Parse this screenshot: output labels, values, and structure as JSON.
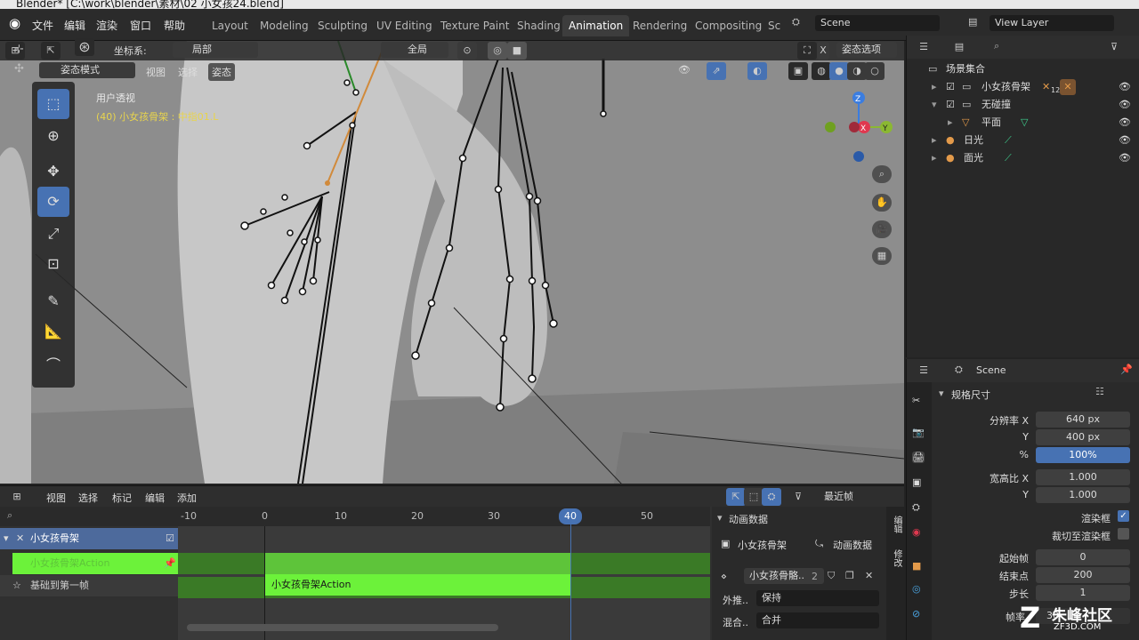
{
  "window": {
    "title": "Blender* [C:\\work\\blender\\素材\\02 小女孩24.blend]"
  },
  "top_menu": [
    "文件",
    "编辑",
    "渲染",
    "窗口",
    "帮助"
  ],
  "workspaces": [
    "Layout",
    "Modeling",
    "Sculpting",
    "UV Editing",
    "Texture Paint",
    "Shading",
    "Animation",
    "Rendering",
    "Compositing",
    "Sc"
  ],
  "active_workspace": "Animation",
  "scene_field": "Scene",
  "view_layer_field": "View Layer",
  "header": {
    "coord_label": "坐标系:",
    "coord_value": "局部",
    "pivot_value": "全局",
    "pose_options": "姿态选项"
  },
  "viewport": {
    "mode": "姿态模式",
    "menus": [
      "视图",
      "选择",
      "姿态"
    ],
    "view_name": "用户透视",
    "selected_info": "(40) 小女孩骨架 : 中指01.L",
    "gizmo": {
      "z": "Z",
      "x": "X",
      "y": "Y"
    }
  },
  "outliner": {
    "search_placeholder": "",
    "rows": [
      {
        "label": "场景集合"
      },
      {
        "label": "小女孩骨架",
        "badge": "12"
      },
      {
        "label": "无碰撞"
      },
      {
        "label": "平面"
      },
      {
        "label": "日光"
      },
      {
        "label": "面光"
      }
    ]
  },
  "properties": {
    "scene": "Scene",
    "section": "规格尺寸",
    "fields": [
      {
        "label": "分辨率 X",
        "value": "640 px"
      },
      {
        "label": "Y",
        "value": "400 px"
      },
      {
        "label": "%",
        "value": "100%"
      },
      {
        "label": "宽高比 X",
        "value": "1.000"
      },
      {
        "label": "Y",
        "value": "1.000"
      }
    ],
    "render_region": "渲染框",
    "crop_region": "裁切至渲染框",
    "frame_fields": [
      {
        "label": "起始帧",
        "value": "0"
      },
      {
        "label": "结束点",
        "value": "200"
      },
      {
        "label": "步长",
        "value": "1"
      }
    ],
    "frame_rate_label": "帧率",
    "frame_rate_value": "30"
  },
  "nla": {
    "menus": [
      "视图",
      "选择",
      "标记",
      "编辑",
      "添加"
    ],
    "snap_value": "最近帧",
    "ruler": [
      "-10",
      "0",
      "10",
      "20",
      "30",
      "40",
      "50"
    ],
    "current_frame": "40",
    "track_armature": "小女孩骨架",
    "track_action_row": "小女孩骨架Action",
    "track_nla": "基础到第一帧",
    "strip_label": "小女孩骨架Action",
    "sidebar": {
      "section": "动画数据",
      "obj_label": "小女孩骨架",
      "anim_label": "动画数据",
      "action_field": "小女孩骨骼..",
      "action_users": "2",
      "extrapolation_label": "外推..",
      "extrapolation_value": "保持",
      "blend_label": "混合..",
      "blend_value": "合并"
    },
    "side_tabs": [
      "编辑",
      "修改"
    ]
  },
  "watermark": {
    "name": "朱峰社区",
    "url": "ZF3D.COM"
  }
}
